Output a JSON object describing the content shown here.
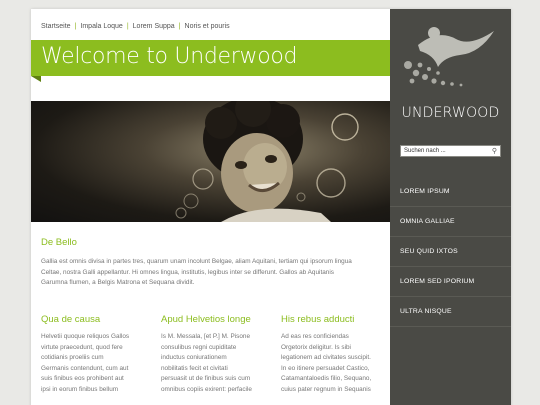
{
  "topnav": {
    "items": [
      "Startseite",
      "Impala Loque",
      "Lorem Suppa",
      "Noris et pouris"
    ],
    "separator": "|"
  },
  "banner": {
    "title": "Welcome to Underwood"
  },
  "hero": {
    "image_description_icon": "child-bubbles-photo"
  },
  "intro": {
    "heading": "De Bello",
    "text_lines": [
      "Gallia est omnis divisa in partes tres, quarum unam incolunt Belgae, aliam Aquitani, tertiam qui ipsorum lingua",
      "Celtae, nostra Galli appellantur. Hi omnes lingua, institutis, legibus inter se differunt. Gallos ab Aquitanis",
      "Garumna flumen, a Belgis Matrona et Sequana dividit."
    ]
  },
  "columns": [
    {
      "heading": "Qua de causa",
      "lines": [
        "Helvetii quoque reliquos Gallos",
        "virtute praecedunt, quod fere",
        "cotidianis proeliis cum",
        "Germanis contendunt, cum aut",
        "suis finibus eos prohibent aut",
        "ipsi in eorum finibus bellum"
      ]
    },
    {
      "heading": "Apud Helvetios longe",
      "lines": [
        "Is M. Messala, [et P.] M. Pisone",
        "consulibus regni cupiditate",
        "inductus coniurationem",
        "nobilitatis fecit et civitati",
        "persuasit ut de finibus suis cum",
        "omnibus copiis exirent: perfacile"
      ]
    },
    {
      "heading": "His rebus adducti",
      "lines": [
        "Ad eas res conficiendas",
        "Orgetorix deligitur. Is sibi",
        "legationem ad civitates suscipit.",
        "In eo itinere persuadet Castico,",
        "Catamantaloedis filio, Sequano,",
        "cuius pater regnum in Sequanis"
      ]
    }
  ],
  "sidebar": {
    "brand": "UNDERWOOD",
    "logo_icon": "swimmer-bubbles-logo-icon",
    "search": {
      "value": "Suchen nach ...",
      "icon": "search-icon"
    },
    "menu": [
      "LOREM IPSUM",
      "OMNIA GALLIAE",
      "SEU QUID IXTOS",
      "LOREM SED IPORIUM",
      "ULTRA NISQUE"
    ]
  },
  "colors": {
    "accent": "#8cbd1f",
    "sidebar": "#4a4a45",
    "background": "#e9e9e6"
  }
}
